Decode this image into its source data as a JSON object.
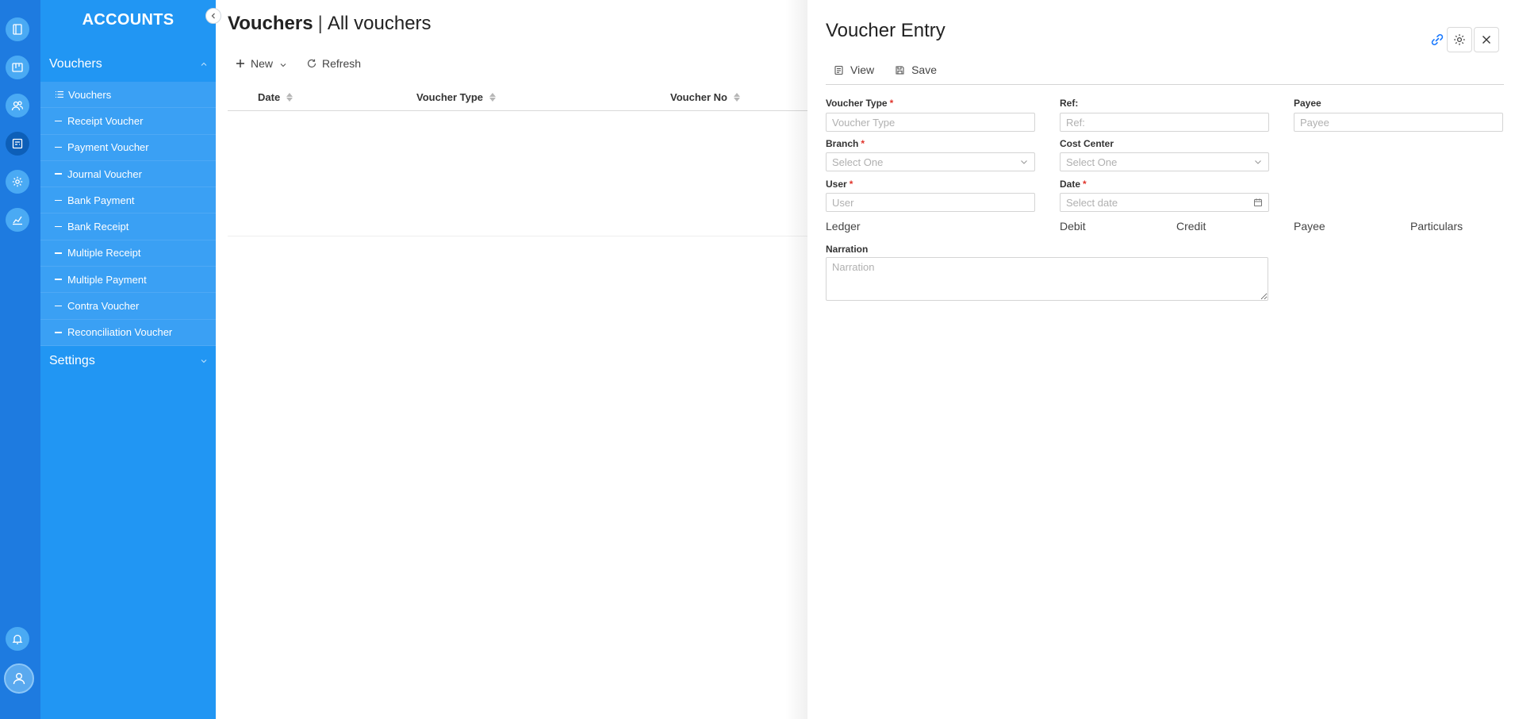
{
  "rail": {
    "icons": [
      "book-icon",
      "board-icon",
      "users-icon",
      "ledger-icon",
      "settings-icon",
      "chart-icon"
    ],
    "bottom_icons": [
      "bell-icon",
      "user-avatar-icon"
    ]
  },
  "sidebar": {
    "title": "ACCOUNTS",
    "sections": [
      {
        "label": "Vouchers",
        "expanded": true
      },
      {
        "label": "Settings",
        "expanded": false
      }
    ],
    "items": [
      {
        "label": "Vouchers"
      },
      {
        "label": "Receipt Voucher"
      },
      {
        "label": "Payment Voucher"
      },
      {
        "label": "Journal Voucher"
      },
      {
        "label": "Bank Payment"
      },
      {
        "label": "Bank Receipt"
      },
      {
        "label": "Multiple Receipt"
      },
      {
        "label": "Multiple Payment"
      },
      {
        "label": "Contra Voucher"
      },
      {
        "label": "Reconciliation Voucher"
      }
    ]
  },
  "main": {
    "title_bold": "Vouchers",
    "title_separator": "|",
    "title_rest": "All vouchers",
    "toolbar": {
      "new_label": "New",
      "refresh_label": "Refresh"
    },
    "columns": [
      "Date",
      "Voucher Type",
      "Voucher No"
    ]
  },
  "drawer": {
    "title": "Voucher Entry",
    "tabs": {
      "view_label": "View",
      "save_label": "Save"
    },
    "fields": {
      "voucher_type": {
        "label": "Voucher Type",
        "required": "*",
        "placeholder": "Voucher Type",
        "value": ""
      },
      "ref": {
        "label": "Ref:",
        "placeholder": "Ref:",
        "value": ""
      },
      "payee": {
        "label": "Payee",
        "placeholder": "Payee",
        "value": ""
      },
      "branch": {
        "label": "Branch",
        "required": "*",
        "placeholder": "Select One"
      },
      "cost_center": {
        "label": "Cost Center",
        "placeholder": "Select One"
      },
      "user": {
        "label": "User",
        "required": "*",
        "placeholder": "User",
        "value": ""
      },
      "date": {
        "label": "Date",
        "required": "*",
        "placeholder": "Select date"
      },
      "narration": {
        "label": "Narration",
        "placeholder": "Narration",
        "value": ""
      }
    },
    "grid_columns": [
      "Ledger",
      "Debit",
      "Credit",
      "Payee",
      "Particulars"
    ]
  },
  "colors": {
    "rail": "#1e7be0",
    "sidebar": "#2196f3",
    "sidebar_sub": "#3aa0f4",
    "required": "#e0342b",
    "link_icon": "#1677ff"
  }
}
